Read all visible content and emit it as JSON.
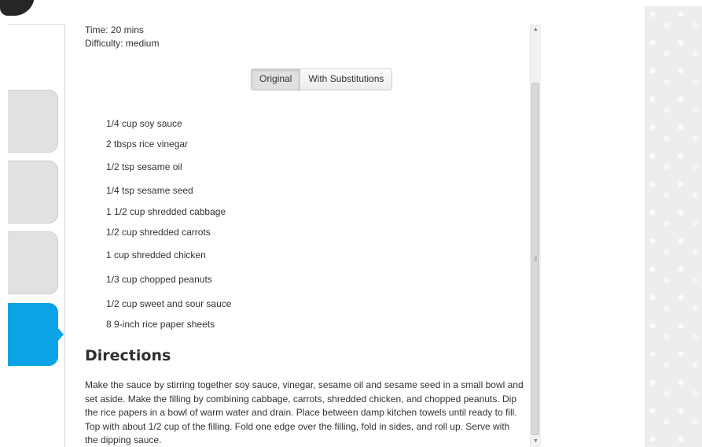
{
  "recipe": {
    "time": "Time: 20 mins",
    "difficulty": "Difficulty: medium"
  },
  "toggle": {
    "original_label": "Original",
    "substitutions_label": "With Substitutions",
    "selected": "Original"
  },
  "ingredients": [
    "1/4 cup soy sauce",
    "2 tbsps rice vinegar",
    "1/2 tsp sesame oil",
    "1/4 tsp sesame seed",
    "1 1/2 cup shredded cabbage",
    "1/2 cup shredded carrots",
    "1 cup shredded chicken",
    "1/3 cup chopped peanuts",
    "1/2 cup sweet and sour sauce",
    "8 9-inch rice paper sheets"
  ],
  "directions": {
    "heading": "Directions",
    "text": "Make the sauce by stirring together soy sauce, vinegar, sesame oil and sesame seed in a small bowl and set aside. Make the filling by combining cabbage, carrots, shredded chicken, and chopped peanuts. Dip the rice papers in a bowl of warm water and drain. Place between damp kitchen towels until ready to fill. Top with about 1/2 cup of the filling. Fold one edge over the filling, fold in sides, and roll up. Serve with the dipping sauce."
  },
  "scrollbar": {
    "up_icon": "triangle-up",
    "down_icon": "triangle-down"
  },
  "colors": {
    "active_tab": "#0ba3e6",
    "inactive_tab": "#e1e1e1"
  },
  "icons": {
    "scroll_up": "scroll-up-arrow-icon",
    "scroll_down": "scroll-down-arrow-icon",
    "grip": "scroll-grip-icon"
  }
}
